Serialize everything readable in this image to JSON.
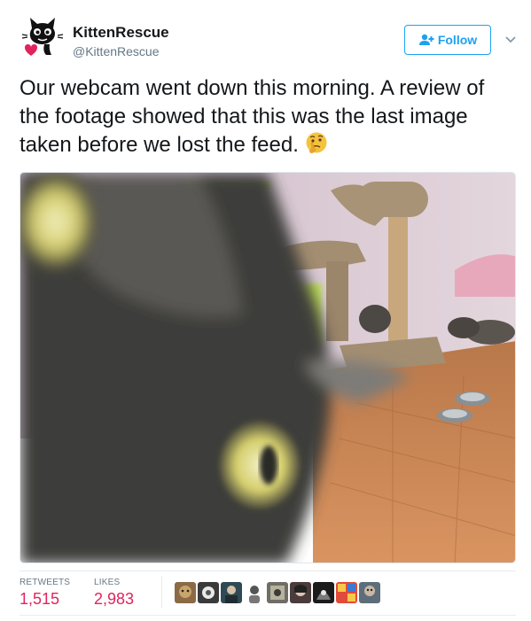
{
  "user": {
    "display_name": "KittenRescue",
    "handle": "@KittenRescue",
    "avatar_icon": "cat-heart-avatar"
  },
  "actions": {
    "follow_label": "Follow",
    "follow_icon": "add-user-icon",
    "more_icon": "chevron-down-icon"
  },
  "tweet": {
    "text": "Our webcam went down this morning. A review of the footage showed that this was the last image taken before we lost the feed.",
    "emoji": "thinking-face-emoji"
  },
  "stats": {
    "retweets_label": "RETWEETS",
    "retweets_count": "1,515",
    "likes_label": "LIKES",
    "likes_count": "2,983"
  },
  "liker_avatars": [
    "liker-avatar-1",
    "liker-avatar-2",
    "liker-avatar-3",
    "liker-avatar-4",
    "liker-avatar-5",
    "liker-avatar-6",
    "liker-avatar-7",
    "liker-avatar-8",
    "liker-avatar-9"
  ],
  "colors": {
    "accent_blue": "#1da1f2",
    "count_red": "#e0245e",
    "secondary_text": "#657786"
  }
}
